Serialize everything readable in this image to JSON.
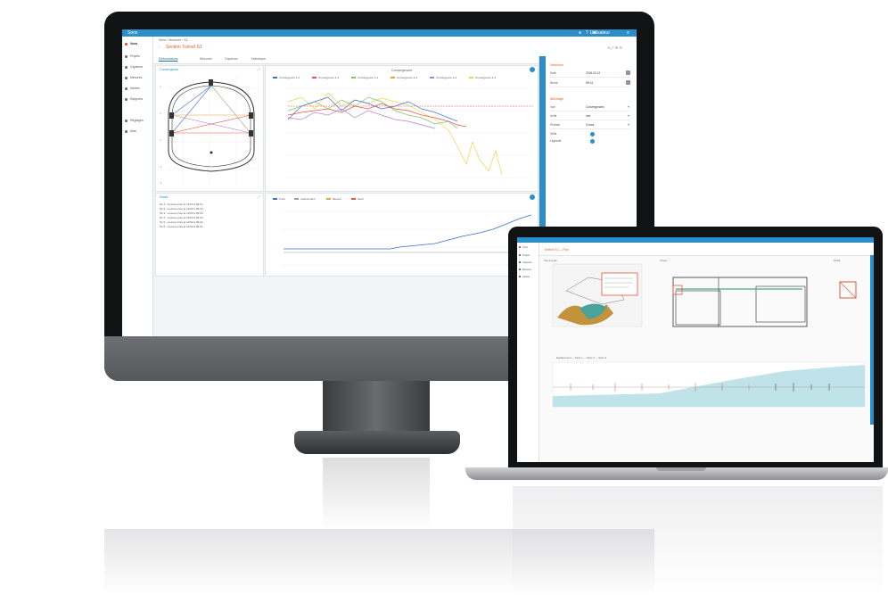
{
  "monitor_app": {
    "window_title": "Sens",
    "user": "Utilisateur",
    "sidebar": [
      "Vues",
      "Projets",
      "Capteurs",
      "Mesures",
      "Alertes",
      "Rapports",
      "Réglages",
      "Aide"
    ],
    "breadcrumb": "Sens  ›  Mesures  ›  S1",
    "page_title": "Section Tunnel S1",
    "toolbar": "⟲  ⤢  ⚙  ☰",
    "tabs": [
      "Déformations",
      "Mesures",
      "Capteurs",
      "Historique"
    ],
    "section_panel": {
      "title": "Convergence",
      "scale_labels": [
        "4",
        "2",
        "0",
        "-2",
        "-4"
      ]
    },
    "series_panel": {
      "title": "Convergences",
      "legend": [
        "Convergence 1-2",
        "Convergence 1-3",
        "Convergence 1-4",
        "Convergence 2-3",
        "Convergence 2-4",
        "Convergence 3-4"
      ],
      "colors": [
        "#3f6fd1",
        "#e0563f",
        "#7cc36a",
        "#e8a33a",
        "#b67fd6",
        "#f0d24a"
      ]
    },
    "log_panel": {
      "title": "Notes",
      "lines": [
        "S1.1 : mesure prise le 12/03 à 09:14",
        "S1.2 : mesure prise le 12/03 à 09:16",
        "S1.3 : mesure prise le 12/03 à 09:18",
        "S1.4 : mesure prise le 12/03 à 09:20",
        "S1.5 : mesure prise le 12/03 à 09:22",
        "S1.6 : mesure prise le 12/03 à 09:24"
      ]
    },
    "bottom_panel": {
      "legend": [
        "Front",
        "Avancement",
        "Mesure",
        "Seuil"
      ],
      "colors": [
        "#3f6fd1",
        "#9aa3ad",
        "#e8a33a",
        "#e0563f"
      ]
    },
    "right_panel": {
      "section1": "Sélection",
      "row1_label": "Date",
      "row1_value": "2018-03-12",
      "row2_label": "Heure",
      "row2_value": "09:14",
      "section2": "Affichage",
      "rows": [
        {
          "label": "Vue",
          "value": "Convergences"
        },
        {
          "label": "Unité",
          "value": "mm"
        },
        {
          "label": "Période",
          "value": "3 mois"
        }
      ],
      "toggle1": "Grille",
      "toggle2": "Légende"
    }
  },
  "laptop_app": {
    "page_title": "Section S1  —  Plan",
    "sidebar": [
      "Vues",
      "Projets",
      "Capteurs",
      "Mesures",
      "Alertes"
    ],
    "panels": [
      "Vue en plan",
      "Coupe",
      "Détail"
    ],
    "chart_legend": "Déplacement  —  Série 1  —  Série 2  —  Série 3"
  }
}
